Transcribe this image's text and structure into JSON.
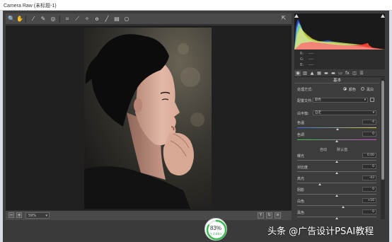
{
  "window": {
    "title": "Camera Raw (未标题-1)"
  },
  "toolbar": {
    "tools": [
      {
        "icon": "zoom-icon",
        "glyph": "🔍"
      },
      {
        "icon": "hand-icon",
        "glyph": "✋"
      },
      {
        "icon": "white-balance-icon",
        "glyph": "⁄"
      },
      {
        "icon": "color-sampler-icon",
        "glyph": "✎"
      },
      {
        "icon": "target-adjust-icon",
        "glyph": "◎"
      },
      {
        "icon": "crop-icon",
        "glyph": "⌗"
      },
      {
        "icon": "straighten-icon",
        "glyph": "⟋"
      },
      {
        "icon": "spot-removal-icon",
        "glyph": "✧"
      },
      {
        "icon": "red-eye-icon",
        "glyph": "ɵ"
      },
      {
        "icon": "adjustment-brush-icon",
        "glyph": "╱"
      },
      {
        "icon": "graduated-filter-icon",
        "glyph": "▤"
      },
      {
        "icon": "radial-filter-icon",
        "glyph": "○"
      }
    ],
    "fullscreen_glyph": "⇱"
  },
  "canvas_footer": {
    "zoom_minus": "−",
    "zoom_plus": "+",
    "zoom_value": "59%",
    "zoom_caret": "▾",
    "view_buttons": [
      "Y",
      "⇅",
      "≡"
    ]
  },
  "histogram": {
    "rgb_rows": [
      {
        "label": "R:",
        "value": "----"
      },
      {
        "label": "G:",
        "value": "----"
      },
      {
        "label": "B:",
        "value": "----"
      }
    ]
  },
  "panel_tabs": [
    "◉",
    "▥",
    "▲",
    "▦",
    "▬",
    "▬",
    "▭",
    "fx",
    "◫",
    "☰"
  ],
  "basic_panel": {
    "title": "基本",
    "treatment_label": "处理方式:",
    "treatment_options": [
      "颜色",
      "黑白"
    ],
    "profile_label": "配置文件:",
    "profile_value": "颜色",
    "caret": "▾",
    "wb_label": "白平衡:",
    "wb_value": "自定",
    "temperature_label": "色温",
    "temperature_value": "-4",
    "tint_label": "色调",
    "tint_value": "0",
    "auto_link": "自动",
    "default_link": "默认值",
    "exposure_label": "曝光",
    "exposure_value": "0.00",
    "contrast_label": "对比度",
    "contrast_value": "0",
    "highlights_label": "高光",
    "highlights_value": "-43",
    "shadows_label": "阴影",
    "shadows_value": "0",
    "whites_label": "白色",
    "whites_value": "+16",
    "blacks_label": "黑色",
    "blacks_value": "0"
  },
  "progress_badge": {
    "percent": "83%",
    "rate": "↑ 0.6K/s"
  },
  "watermark": "头条 @广告设计PSAI教程"
}
